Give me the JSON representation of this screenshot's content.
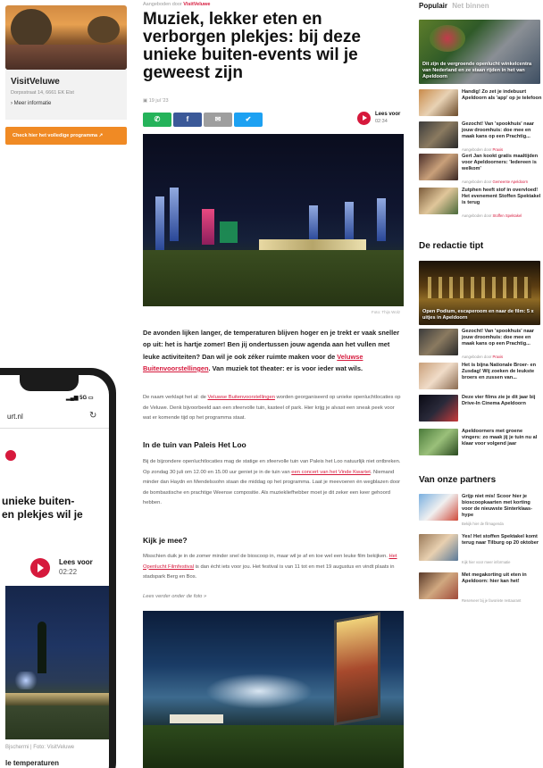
{
  "ad": {
    "brand": "VisitVeluwe",
    "address": "Dorpsstraat 14, 6661 EK Elst",
    "more_info": "Meer informatie",
    "cta": "Check hier het volledige programma"
  },
  "phone": {
    "status": "5G",
    "url": "urt.nl",
    "title": "unieke buiten-\nen plekjes wil je",
    "listen_label": "Lees voor",
    "listen_time": "02:22",
    "caption": "Bjschermi | Foto: VisitVeluwe",
    "body_start": "le temperaturen"
  },
  "article": {
    "sponsor_prefix": "Aangeboden door",
    "sponsor_name": "VisitVeluwe",
    "title": "Muziek, lekker eten en verborgen plekjes: bij deze unieke buiten-events wil je geweest zijn",
    "date": "19 jul '23",
    "share": {
      "whatsapp": "✆",
      "facebook": "f",
      "email": "✉",
      "twitter": "✔"
    },
    "listen_label": "Lees voor",
    "listen_time": "02:34",
    "hero_caption": "Foto: Thijs Wolz",
    "intro_1": "De avonden lijken langer, de temperaturen blijven hoger en je trekt er vaak sneller op uit: het is hartje zomer! Ben jij ondertussen jouw agenda aan het vullen met leuke activiteiten? Dan wil je ook zéker ruimte maken voor de ",
    "intro_link": "Veluwse Buitenvoorstellingen",
    "intro_2": ". Van muziek tot theater: er is voor ieder wat wils.",
    "p1_a": "De naam verklapt het al: de ",
    "p1_link": "Veluwse Buitenvoorstellingen",
    "p1_b": " worden georganiseerd op unieke openluchtlocaties op de Veluwe. Denk bijvoorbeeld aan een sfeervolle tuin, kasteel of park. Hier krijg je alvast een sneak peek voor wat er komende tijd op het programma staat.",
    "h2_1": "In de tuin van Paleis Het Loo",
    "p2_a": "Bij de bijzondere openluchtlocaties mag de statige en sfeervolle tuin van Paleis het Loo natuurlijk niet ontbreken. Op zondag 30 juli om 12.00 en 15.00 uur geniet je in de tuin van ",
    "p2_link": "een concert van het Vinde Kwartet",
    "p2_b": ". Niemand minder dan Haydn en Mendelssohn staan die middag op het programma. Laat je meevoeren én wegblazen door de bombastische en prachtige Weense compositie. Als muziekliefhebber moet je dit zeker een keer gehoord hebben.",
    "h2_2": "Kijk je mee?",
    "p3_a": "Misschien duik je in de zomer minder snel de bioscoop in, maar wil je af en toe wel een leuke film bekijken. ",
    "p3_link": "Het Openlucht Filmfestival",
    "p3_b": " is dan écht iets voor jou. Het festival is van 11 tot en met 19 augustus en vindt plaats in stadspark Berg en Bos.",
    "more_photo": "Lees verder onder de foto »"
  },
  "sidebar": {
    "tab_active": "Populair",
    "tab_inactive": "Net binnen",
    "popular_feature": "Dit zijn de vergroende openlucht winkelcentra van Nederland en ze staan rijden in het van Apeldoorn",
    "popular": [
      {
        "title": "Handig! Zo zet je indebuurt Apeldoorn als 'app' op je telefoon",
        "sub": ""
      },
      {
        "title": "Gezocht! Van 'spookhuis' naar jouw droomhuis: doe mee en maak kans op een Prachtig...",
        "sub_prefix": "Aangeboden door",
        "sub_name": "Praxis"
      },
      {
        "title": "Gert Jan kookt gratis maaltijden voor Apeldoorners: 'Iedereen is welkom'",
        "sub_prefix": "Aangeboden door",
        "sub_name": "Gemeente Apeldoorn"
      },
      {
        "title": "Zutphen heeft stof in overvloed! Het evenement Stoffen Spektakel is terug",
        "sub_prefix": "Aangeboden door",
        "sub_name": "Stoffen Spektakel"
      }
    ],
    "editors_heading": "De redactie tipt",
    "editors_feature": "Open Podium, escaperoom en naar de film: 5 x uitjes in Apeldoorn",
    "editors": [
      {
        "title": "Gezocht! Van 'spookhuis' naar jouw droomhuis: doe mee en maak kans op een Prachtig...",
        "sub_prefix": "Aangeboden door",
        "sub_name": "Praxis"
      },
      {
        "title": "Het is bijna Nationale Broer- en Zusdag! Wij zoeken de leukste broers en zussen van...",
        "sub": ""
      },
      {
        "title": "Deze vier films zie je dit jaar bij Drive-In Cinema Apeldoorn",
        "sub": ""
      },
      {
        "title": "Apeldoorners met groene vingers: zo maak jij je tuin nu al klaar voor volgend jaar",
        "sub": ""
      }
    ],
    "partners_heading": "Van onze partners",
    "partners": [
      {
        "title": "Grijp niet mis! Scoor hier je bioscoopkaarten met korting voor de nieuwste Sinterklaas-hype",
        "sub": "Bekijk hier de filmagenda"
      },
      {
        "title": "Yes! Het stoffen Spektakel komt terug naar Tilburg op 20 oktober",
        "sub": "Kijk hier voor meer informatie"
      },
      {
        "title": "Met megakorting uit eten in Apeldoorn: hier kan het!",
        "sub": "Reserveer bij je favoriete restaurant"
      }
    ]
  }
}
